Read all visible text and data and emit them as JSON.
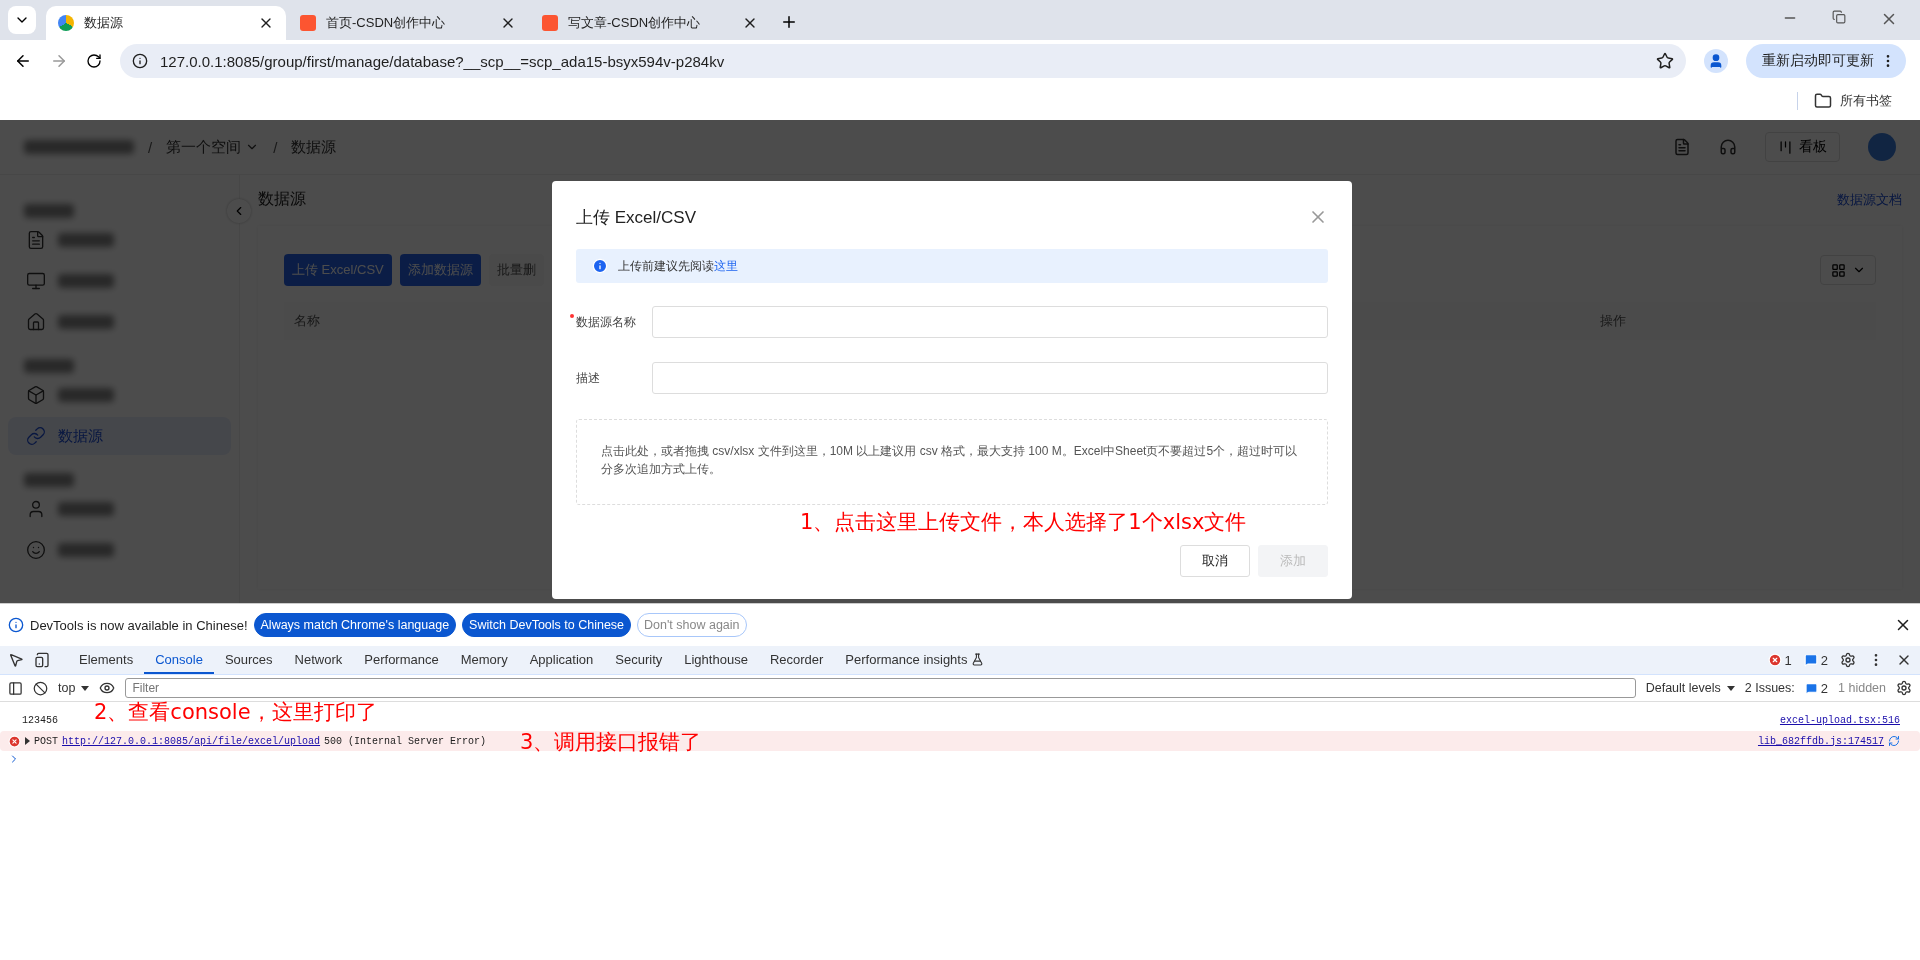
{
  "browser": {
    "tabs": [
      {
        "title": "数据源",
        "selected": true,
        "kind": "app"
      },
      {
        "title": "首页-CSDN创作中心",
        "selected": false,
        "kind": "csdn"
      },
      {
        "title": "写文章-CSDN创作中心",
        "selected": false,
        "kind": "csdn"
      }
    ],
    "address": "127.0.0.1:8085/group/first/manage/database?__scp__=scp_ada15-bsyx594v-p284kv",
    "update_button": "重新启动即可更新",
    "bookmarks": "所有书签"
  },
  "app": {
    "breadcrumb": [
      {
        "kind": "separator",
        "label": "/"
      },
      {
        "kind": "dropdown",
        "label": "第一个空间"
      },
      {
        "kind": "separator",
        "label": "/"
      },
      {
        "kind": "crumb",
        "label": "数据源"
      }
    ],
    "header_button": "看板",
    "sidebar": [
      {
        "kind": "section"
      },
      {
        "kind": "item",
        "selected": false
      },
      {
        "kind": "item",
        "selected": false
      },
      {
        "kind": "item",
        "selected": false
      },
      {
        "kind": "section"
      },
      {
        "kind": "item",
        "selected": false
      },
      {
        "kind": "item",
        "label": "数据源",
        "selected": true
      },
      {
        "kind": "section"
      },
      {
        "kind": "item",
        "selected": false
      },
      {
        "kind": "item",
        "selected": false
      }
    ],
    "page_title": "数据源",
    "doc_link": "数据源文档",
    "buttons": [
      {
        "label": "上传 Excel/CSV",
        "disabled": false
      },
      {
        "label": "添加数据源",
        "disabled": false
      },
      {
        "label": "批量删",
        "disabled": true
      }
    ],
    "table": {
      "columns": [
        "名称",
        "操作"
      ]
    }
  },
  "modal": {
    "title": "上传 Excel/CSV",
    "alert": {
      "text": "上传前建议先阅读",
      "link": "这里"
    },
    "fields": [
      {
        "label": "数据源名称",
        "required": true
      },
      {
        "label": "描述",
        "required": false
      }
    ],
    "upload_hint": "点击此处，或者拖拽 csv/xlsx 文件到这里，10M 以上建议用 csv 格式，最大支持 100 M。Excel中Sheet页不要超过5个，超过时可以分多次追加方式上传。",
    "buttons": [
      {
        "label": "取消",
        "disabled": false
      },
      {
        "label": "添加",
        "disabled": true
      }
    ]
  },
  "devtools": {
    "info": "DevTools is now available in Chinese!",
    "info_buttons": [
      {
        "label": "Always match Chrome's language",
        "kind": "primary"
      },
      {
        "label": "Switch DevTools to Chinese",
        "kind": "primary"
      },
      {
        "label": "Don't show again",
        "kind": "outline"
      }
    ],
    "tabs": [
      {
        "label": "Elements",
        "selected": false
      },
      {
        "label": "Console",
        "selected": true
      },
      {
        "label": "Sources",
        "selected": false
      },
      {
        "label": "Network",
        "selected": false
      },
      {
        "label": "Performance",
        "selected": false
      },
      {
        "label": "Memory",
        "selected": false
      },
      {
        "label": "Application",
        "selected": false
      },
      {
        "label": "Security",
        "selected": false
      },
      {
        "label": "Lighthouse",
        "selected": false
      },
      {
        "label": "Recorder",
        "selected": false
      },
      {
        "label": "Performance insights",
        "selected": false
      }
    ],
    "error_count": "1",
    "message_count": "2",
    "context": "top",
    "filter_placeholder": "Filter",
    "levels": "Default levels",
    "issues_label": "2 Issues:",
    "issues_count": "2",
    "hidden": "1 hidden",
    "messages": [
      {
        "kind": "log",
        "text": "123456",
        "source": "excel-upload.tsx:516"
      },
      {
        "kind": "error",
        "method": "POST",
        "url": "http://127.0.0.1:8085/api/file/excel/upload",
        "text": "500 (Internal Server Error)",
        "source": "lib_682ffdb.js:174517"
      }
    ]
  },
  "annotations": [
    "1、点击这里上传文件，本人选择了1个xlsx文件",
    "2、查看console，这里打印了",
    "3、调用接口报错了"
  ]
}
